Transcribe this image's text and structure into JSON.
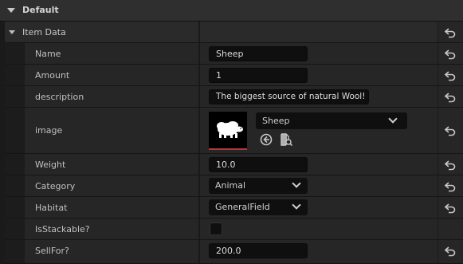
{
  "category": {
    "title": "Default"
  },
  "group": {
    "label": "Item Data"
  },
  "fields": {
    "name": {
      "label": "Name",
      "value": "Sheep"
    },
    "amount": {
      "label": "Amount",
      "value": "1"
    },
    "description": {
      "label": "description",
      "value": "The biggest source of natural Wool!"
    },
    "image": {
      "label": "image",
      "asset": "Sheep"
    },
    "weight": {
      "label": "Weight",
      "value": "10.0"
    },
    "category": {
      "label": "Category",
      "value": "Animal"
    },
    "habitat": {
      "label": "Habitat",
      "value": "GeneralField"
    },
    "is_stackable": {
      "label": "IsStackable?",
      "checked": false
    },
    "sell_for": {
      "label": "SellFor?",
      "value": "200.0"
    }
  },
  "icons": {
    "reset": "reset-to-default-icon",
    "use_selected": "use-selected-asset-icon",
    "browse": "browse-asset-icon",
    "expand": "expand-arrow-icon"
  },
  "colors": {
    "panel_bg": "#1a1a1a",
    "row_bg": "#262626",
    "field_bg": "#0f0f0f",
    "thumb_border": "#b33a3a"
  }
}
